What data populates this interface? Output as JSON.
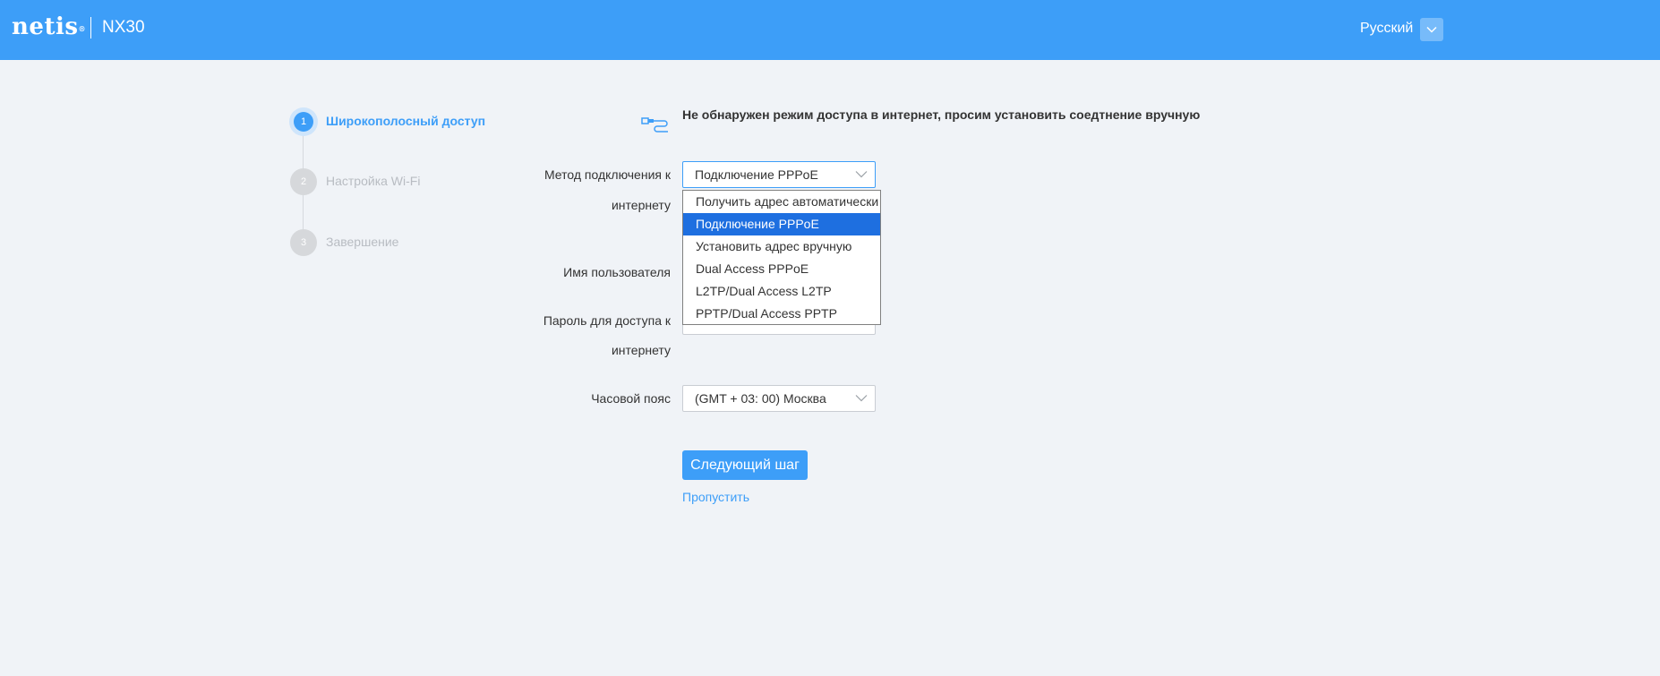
{
  "header": {
    "brand": "netis",
    "brand_mark": "®",
    "model": "NX30",
    "language": "Русский",
    "language_icon": "chevron-down-icon"
  },
  "steps": [
    {
      "number": "1",
      "label": "Широкополосный доступ",
      "active": true
    },
    {
      "number": "2",
      "label": "Настройка Wi-Fi",
      "active": false
    },
    {
      "number": "3",
      "label": "Завершение",
      "active": false
    }
  ],
  "notice": {
    "icon": "ethernet-cable-icon",
    "text": "Не обнаружен режим доступа в интернет, просим установить соедтнение вручную"
  },
  "form": {
    "connection_method": {
      "label_line1": "Метод подключения к",
      "label_line2": "интернету",
      "value": "Подключение PPPoE",
      "options": [
        "Получить адрес автоматически",
        "Подключение PPPoE",
        "Установить адрес вручную",
        "Dual Access PPPoE",
        "L2TP/Dual Access L2TP",
        "PPTP/Dual Access PPTP"
      ],
      "selected_index": 1
    },
    "username": {
      "label": "Имя пользователя"
    },
    "password": {
      "label_line1": "Пароль для доступа к",
      "label_line2": "интернету"
    },
    "timezone": {
      "label": "Часовой пояс",
      "value": "(GMT + 03: 00) Москва"
    }
  },
  "actions": {
    "next": "Следующий шаг",
    "skip": "Пропустить"
  },
  "colors": {
    "accent": "#3d9ef8",
    "selected_option": "#1e6fe0",
    "background": "#f0f3f7"
  }
}
